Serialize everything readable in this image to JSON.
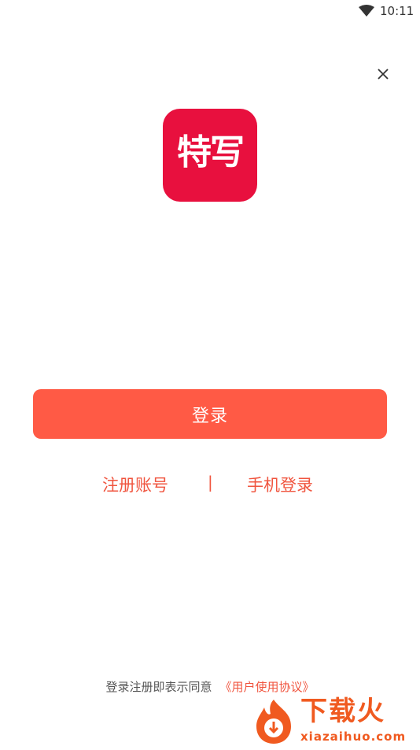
{
  "status_bar": {
    "time": "10:11"
  },
  "logo": {
    "text": "特写",
    "color": "#e8103e"
  },
  "actions": {
    "login_label": "登录",
    "register_label": "注册账号",
    "divider": "|",
    "phone_login_label": "手机登录"
  },
  "agreement": {
    "prefix": "登录注册即表示同意",
    "link_text": "《用户使用协议》"
  },
  "watermark": {
    "title": "下载火",
    "url": "xiazaihuo.com"
  },
  "colors": {
    "accent": "#ff5a45",
    "link": "#f0553f"
  },
  "icons": {
    "wifi": "wifi-icon",
    "close": "close-icon"
  }
}
